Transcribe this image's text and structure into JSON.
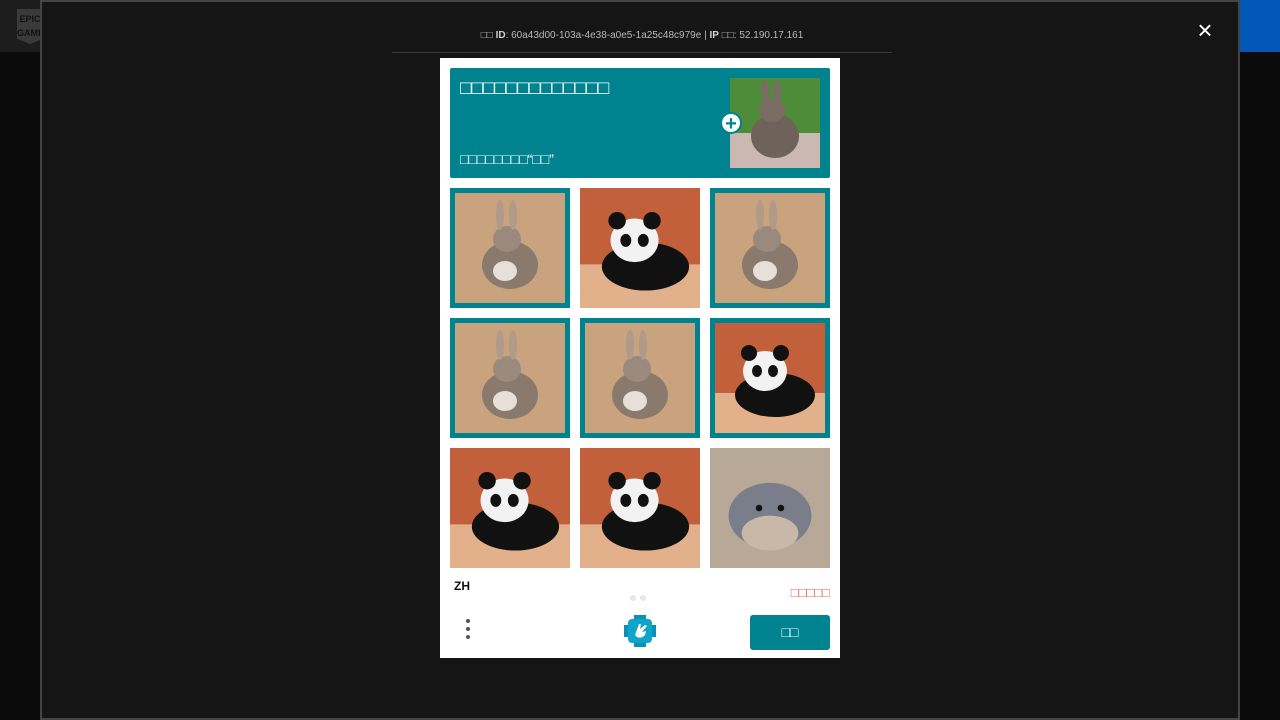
{
  "background": {
    "logo_text": "EPIC GAMES"
  },
  "modal": {
    "meta": {
      "id_prefix": "□□",
      "id_label": "ID",
      "id_value": "60a43d00-103a-4e38-a0e5-1a25c48c979e",
      "separator": "|",
      "ip_label": "IP",
      "ip_suffix": "□□",
      "ip_value": "52.190.17.161"
    },
    "close_label": "×"
  },
  "captcha": {
    "prompt": {
      "title": "□□□□□□□□□□□□□",
      "subtitle": "□□□□□□□□“□□”"
    },
    "tiles": [
      {
        "subject": "rabbit",
        "selected": true
      },
      {
        "subject": "panda",
        "selected": false
      },
      {
        "subject": "rabbit",
        "selected": true
      },
      {
        "subject": "rabbit",
        "selected": true
      },
      {
        "subject": "rabbit",
        "selected": true
      },
      {
        "subject": "panda",
        "selected": true
      },
      {
        "subject": "panda",
        "selected": false
      },
      {
        "subject": "panda",
        "selected": false
      },
      {
        "subject": "hamster",
        "selected": false
      }
    ],
    "language": "ZH",
    "status_text": "□□□□□",
    "verify_label": "□□",
    "colors": {
      "accent": "#00838f",
      "status": "#e8655d"
    }
  }
}
